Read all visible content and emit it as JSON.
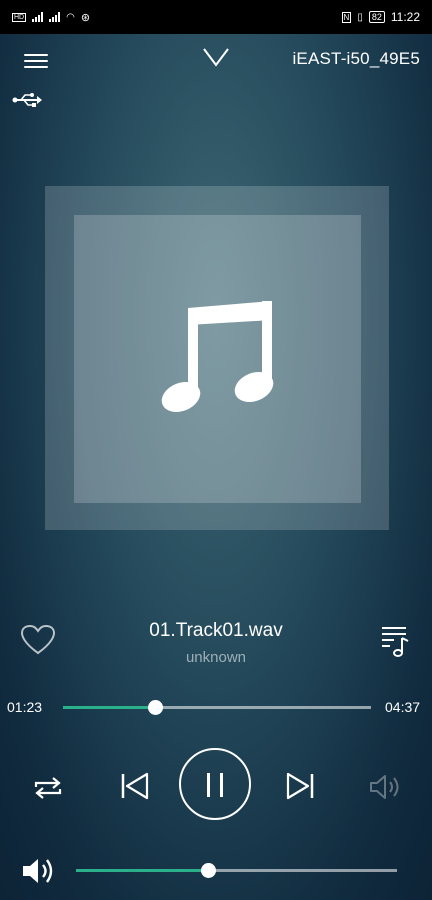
{
  "status_bar": {
    "time": "11:22",
    "battery": "82"
  },
  "header": {
    "device_name": "iEAST-i50_49E5"
  },
  "track": {
    "title": "01.Track01.wav",
    "artist": "unknown"
  },
  "progress": {
    "current": "01:23",
    "total": "04:37",
    "fraction": 0.3
  },
  "volume": {
    "fraction": 0.41
  },
  "colors": {
    "accent": "#2bb08c",
    "background": "#1b3d50"
  },
  "icons": {
    "menu": "menu-icon",
    "collapse": "chevron-down-icon",
    "source": "usb-icon",
    "favorite": "heart-icon",
    "playlist": "playlist-icon",
    "repeat": "repeat-icon",
    "previous": "skip-previous-icon",
    "pause": "pause-icon",
    "next": "skip-next-icon",
    "sound": "speaker-icon",
    "volume": "volume-icon"
  }
}
